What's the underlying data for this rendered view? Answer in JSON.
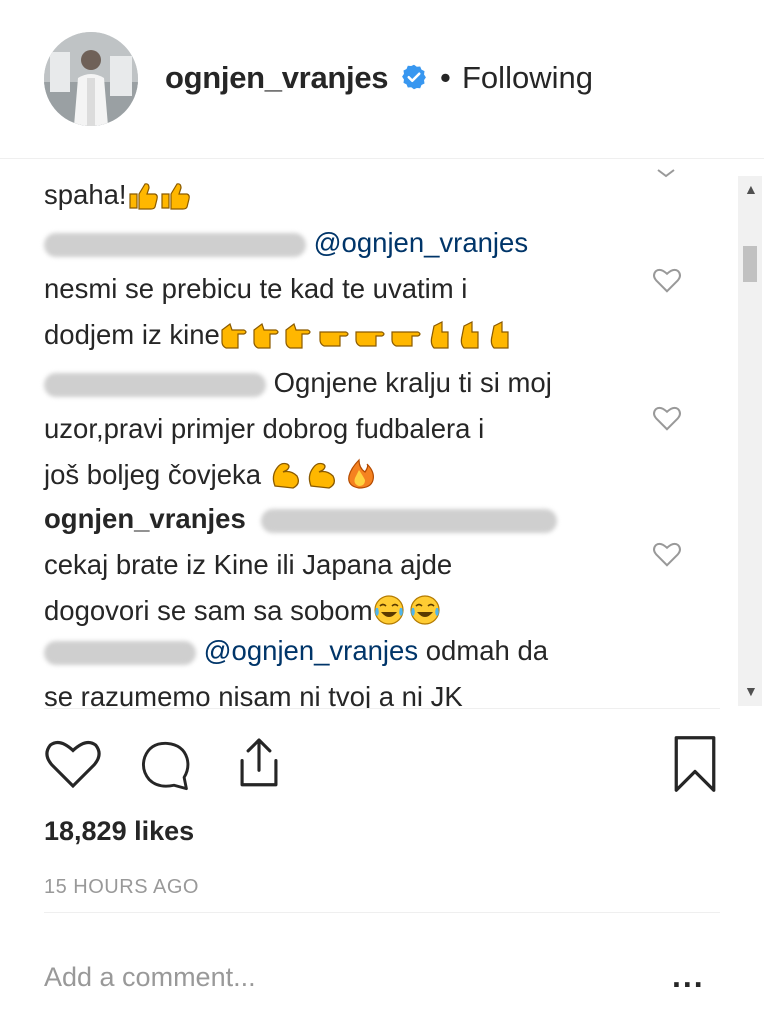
{
  "header": {
    "username": "ognjen_vranjes",
    "separator": "•",
    "follow_status": "Following"
  },
  "comments": [
    {
      "lines": [
        "spaha!"
      ],
      "emoji": [
        "thumbs-up-icon",
        "thumbs-up-icon"
      ]
    },
    {
      "mention": "@ognjen_vranjes",
      "lines": [
        "nesmi se prebicu te kad te uvatim i",
        "dodjem iz kine"
      ],
      "emoji": [
        "pointing-hand-icon",
        "pointing-hand-icon",
        "pointing-hand-icon",
        "pointing-hand-icon",
        "pointing-hand-icon",
        "pointing-hand-icon",
        "pointing-hand-icon",
        "pointing-hand-icon",
        "pointing-hand-icon"
      ]
    },
    {
      "lines": [
        "Ognjene kralju ti si moj",
        "uzor,pravi primjer dobrog fudbalera i",
        "još boljeg čovjeka"
      ],
      "emoji": [
        "flexed-biceps-icon",
        "flexed-biceps-icon",
        "fire-icon"
      ]
    },
    {
      "username": "ognjen_vranjes",
      "lines": [
        "cekaj brate iz Kine ili Japana ajde",
        "dogovori se sam sa sobom"
      ],
      "emoji": [
        "tears-of-joy-icon",
        "tears-of-joy-icon"
      ]
    },
    {
      "mention": "@ognjen_vranjes",
      "lines": [
        "odmah da",
        "se razumemo nisam ni tvoj a ni JK"
      ]
    }
  ],
  "post": {
    "likes": "18,829 likes",
    "time": "15 HOURS AGO"
  },
  "comment_box": {
    "placeholder": "Add a comment...",
    "more": "..."
  },
  "colors": {
    "verified_blue": "#3897f0",
    "mention_blue": "#003569",
    "muted_gray": "#999999",
    "emoji_yellow": "#ffb700"
  }
}
